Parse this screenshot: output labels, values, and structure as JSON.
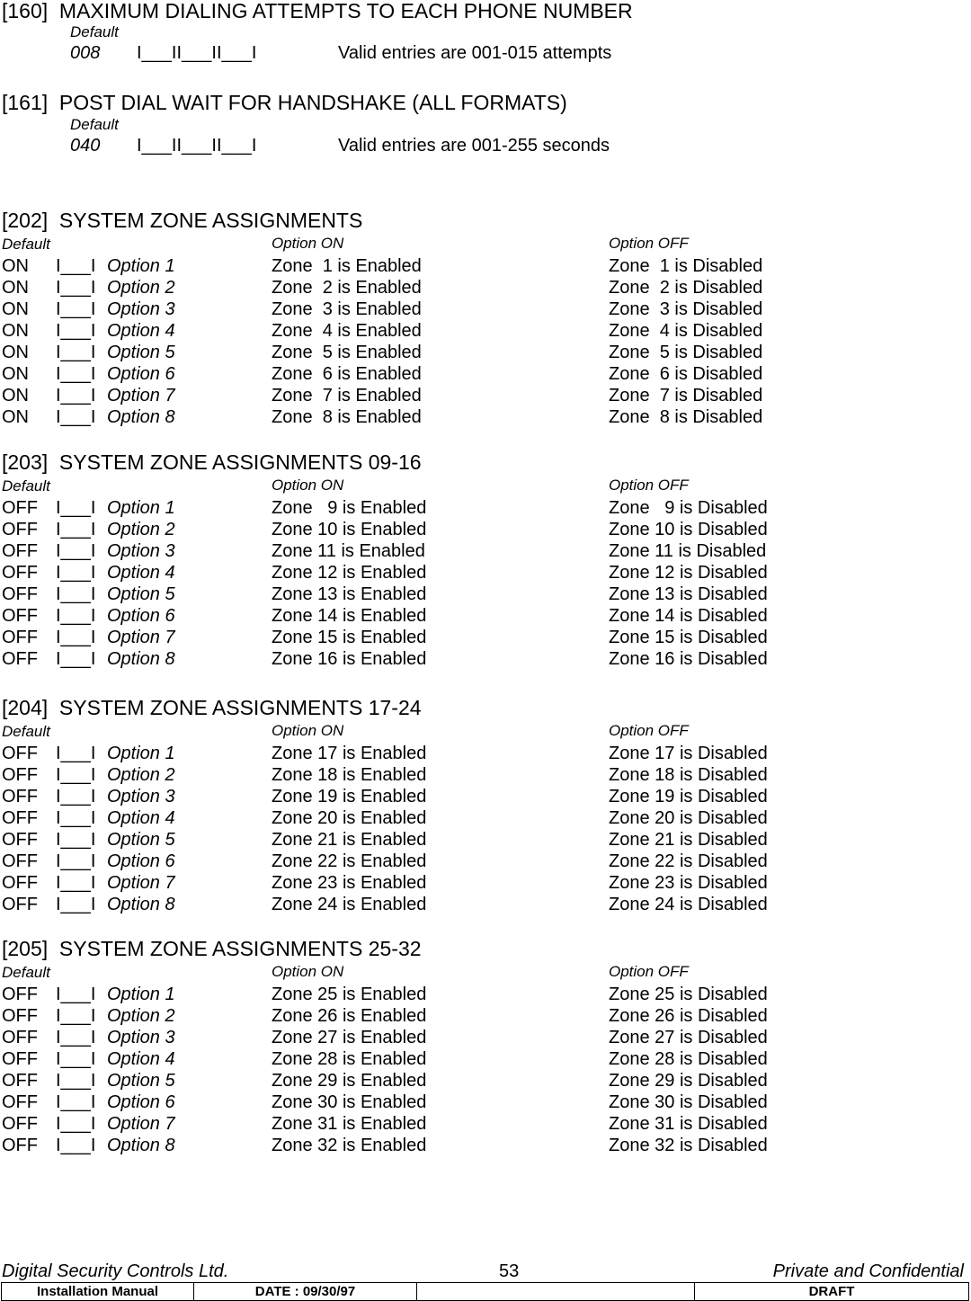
{
  "sections_simple": [
    {
      "heading": "[160]  MAXIMUM DIALING ATTEMPTS TO EACH PHONE NUMBER",
      "default_label": "Default",
      "default_value": "008",
      "entry_boxes": "I___II___II___I",
      "valid_text": "Valid entries are 001-015 attempts"
    },
    {
      "heading": "[161]  POST DIAL WAIT FOR HANDSHAKE (ALL FORMATS)",
      "default_label": "Default",
      "default_value": "040",
      "entry_boxes": "I___II___II___I",
      "valid_text": "Valid entries are 001-255 seconds"
    }
  ],
  "sections_zones": [
    {
      "heading": "[202]  SYSTEM ZONE ASSIGNMENTS",
      "col_default": "Default",
      "col_on": "Option ON",
      "col_off": "Option OFF",
      "rows": [
        {
          "default": "ON",
          "box": "I___I",
          "option": "Option 1",
          "on": "Zone  1 is Enabled",
          "off": "Zone  1 is Disabled"
        },
        {
          "default": "ON",
          "box": "I___I",
          "option": "Option 2",
          "on": "Zone  2 is Enabled",
          "off": "Zone  2 is Disabled"
        },
        {
          "default": "ON",
          "box": "I___I",
          "option": "Option 3",
          "on": "Zone  3 is Enabled",
          "off": "Zone  3 is Disabled"
        },
        {
          "default": "ON",
          "box": "I___I",
          "option": "Option 4",
          "on": "Zone  4 is Enabled",
          "off": "Zone  4 is Disabled"
        },
        {
          "default": "ON",
          "box": "I___I",
          "option": "Option 5",
          "on": "Zone  5 is Enabled",
          "off": "Zone  5 is Disabled"
        },
        {
          "default": "ON",
          "box": "I___I",
          "option": "Option 6",
          "on": "Zone  6 is Enabled",
          "off": "Zone  6 is Disabled"
        },
        {
          "default": "ON",
          "box": "I___I",
          "option": "Option 7",
          "on": "Zone  7 is Enabled",
          "off": "Zone  7 is Disabled"
        },
        {
          "default": "ON",
          "box": "I___I",
          "option": "Option 8",
          "on": "Zone  8 is Enabled",
          "off": "Zone  8 is Disabled"
        }
      ]
    },
    {
      "heading": "[203]  SYSTEM ZONE ASSIGNMENTS 09-16",
      "col_default": "Default",
      "col_on": "Option ON",
      "col_off": "Option OFF",
      "rows": [
        {
          "default": "OFF",
          "box": "I___I",
          "option": "Option 1",
          "on": "Zone   9 is Enabled",
          "off": "Zone   9 is Disabled"
        },
        {
          "default": "OFF",
          "box": "I___I",
          "option": "Option 2",
          "on": "Zone 10 is Enabled",
          "off": "Zone 10 is Disabled"
        },
        {
          "default": "OFF",
          "box": "I___I",
          "option": "Option 3",
          "on": "Zone 11 is Enabled",
          "off": "Zone 11 is Disabled"
        },
        {
          "default": "OFF",
          "box": "I___I",
          "option": "Option 4",
          "on": "Zone 12 is Enabled",
          "off": "Zone 12 is Disabled"
        },
        {
          "default": "OFF",
          "box": "I___I",
          "option": "Option 5",
          "on": "Zone 13 is Enabled",
          "off": "Zone 13 is Disabled"
        },
        {
          "default": "OFF",
          "box": "I___I",
          "option": "Option 6",
          "on": "Zone 14 is Enabled",
          "off": "Zone 14 is Disabled"
        },
        {
          "default": "OFF",
          "box": "I___I",
          "option": "Option 7",
          "on": "Zone 15 is Enabled",
          "off": "Zone 15 is Disabled"
        },
        {
          "default": "OFF",
          "box": "I___I",
          "option": "Option 8",
          "on": "Zone 16 is Enabled",
          "off": "Zone 16 is Disabled"
        }
      ]
    },
    {
      "heading": "[204]  SYSTEM ZONE ASSIGNMENTS 17-24",
      "col_default": "Default",
      "col_on": "Option ON",
      "col_off": "Option OFF",
      "rows": [
        {
          "default": "OFF",
          "box": "I___I",
          "option": "Option 1",
          "on": "Zone 17 is Enabled",
          "off": "Zone 17 is Disabled"
        },
        {
          "default": "OFF",
          "box": "I___I",
          "option": "Option 2",
          "on": "Zone 18 is Enabled",
          "off": "Zone 18 is Disabled"
        },
        {
          "default": "OFF",
          "box": "I___I",
          "option": "Option 3",
          "on": "Zone 19 is Enabled",
          "off": "Zone 19 is Disabled"
        },
        {
          "default": "OFF",
          "box": "I___I",
          "option": "Option 4",
          "on": "Zone 20 is Enabled",
          "off": "Zone 20 is Disabled"
        },
        {
          "default": "OFF",
          "box": "I___I",
          "option": "Option 5",
          "on": "Zone 21 is Enabled",
          "off": "Zone 21 is Disabled"
        },
        {
          "default": "OFF",
          "box": "I___I",
          "option": "Option 6",
          "on": "Zone 22 is Enabled",
          "off": "Zone 22 is Disabled"
        },
        {
          "default": "OFF",
          "box": "I___I",
          "option": "Option 7",
          "on": "Zone 23 is Enabled",
          "off": "Zone 23 is Disabled"
        },
        {
          "default": "OFF",
          "box": "I___I",
          "option": "Option 8",
          "on": "Zone 24 is Enabled",
          "off": "Zone 24 is Disabled"
        }
      ]
    },
    {
      "heading": "[205]  SYSTEM ZONE ASSIGNMENTS 25-32",
      "col_default": "Default",
      "col_on": "Option ON",
      "col_off": "Option OFF",
      "rows": [
        {
          "default": "OFF",
          "box": "I___I",
          "option": "Option 1",
          "on": "Zone 25 is Enabled",
          "off": "Zone 25 is Disabled"
        },
        {
          "default": "OFF",
          "box": "I___I",
          "option": "Option 2",
          "on": "Zone 26 is Enabled",
          "off": "Zone 26 is Disabled"
        },
        {
          "default": "OFF",
          "box": "I___I",
          "option": "Option 3",
          "on": "Zone 27 is Enabled",
          "off": "Zone 27 is Disabled"
        },
        {
          "default": "OFF",
          "box": "I___I",
          "option": "Option 4",
          "on": "Zone 28 is Enabled",
          "off": "Zone 28 is Disabled"
        },
        {
          "default": "OFF",
          "box": "I___I",
          "option": "Option 5",
          "on": "Zone 29 is Enabled",
          "off": "Zone 29 is Disabled"
        },
        {
          "default": "OFF",
          "box": "I___I",
          "option": "Option 6",
          "on": "Zone 30 is Enabled",
          "off": "Zone 30 is Disabled"
        },
        {
          "default": "OFF",
          "box": "I___I",
          "option": "Option 7",
          "on": "Zone 31 is Enabled",
          "off": "Zone 31 is Disabled"
        },
        {
          "default": "OFF",
          "box": "I___I",
          "option": "Option 8",
          "on": "Zone 32 is Enabled",
          "off": "Zone 32 is Disabled"
        }
      ]
    }
  ],
  "footer": {
    "company": "Digital Security Controls Ltd.",
    "page_number": "53",
    "confidentiality": "Private and Confidential",
    "doc_type": "Installation Manual",
    "date": "DATE :  09/30/97",
    "blank": "",
    "status": "DRAFT"
  }
}
